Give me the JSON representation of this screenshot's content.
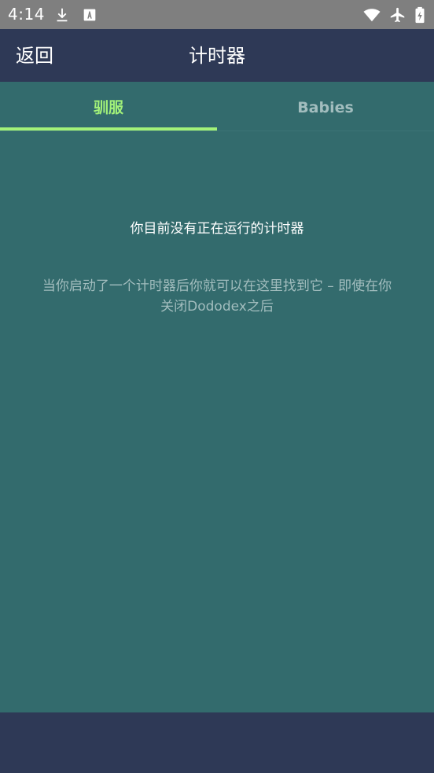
{
  "status_bar": {
    "time": "4:14",
    "icons": [
      "download-icon",
      "font-a-icon",
      "wifi-icon",
      "airplane-mode-icon",
      "battery-icon"
    ]
  },
  "app_bar": {
    "back_label": "返回",
    "title": "计时器"
  },
  "tabs": [
    {
      "label": "驯服",
      "selected": true
    },
    {
      "label": "Babies",
      "selected": false
    }
  ],
  "empty_state": {
    "title": "你目前没有正在运行的计时器",
    "description": "当你启动了一个计时器后你就可以在这里找到它 – 即使在你关闭Dododex之后"
  },
  "colors": {
    "status_bar_bg": "#7f7f7f",
    "app_bar_bg": "#2e3956",
    "content_bg": "#336b6d",
    "accent": "#a3f279",
    "muted_text": "#a2bdbe"
  }
}
